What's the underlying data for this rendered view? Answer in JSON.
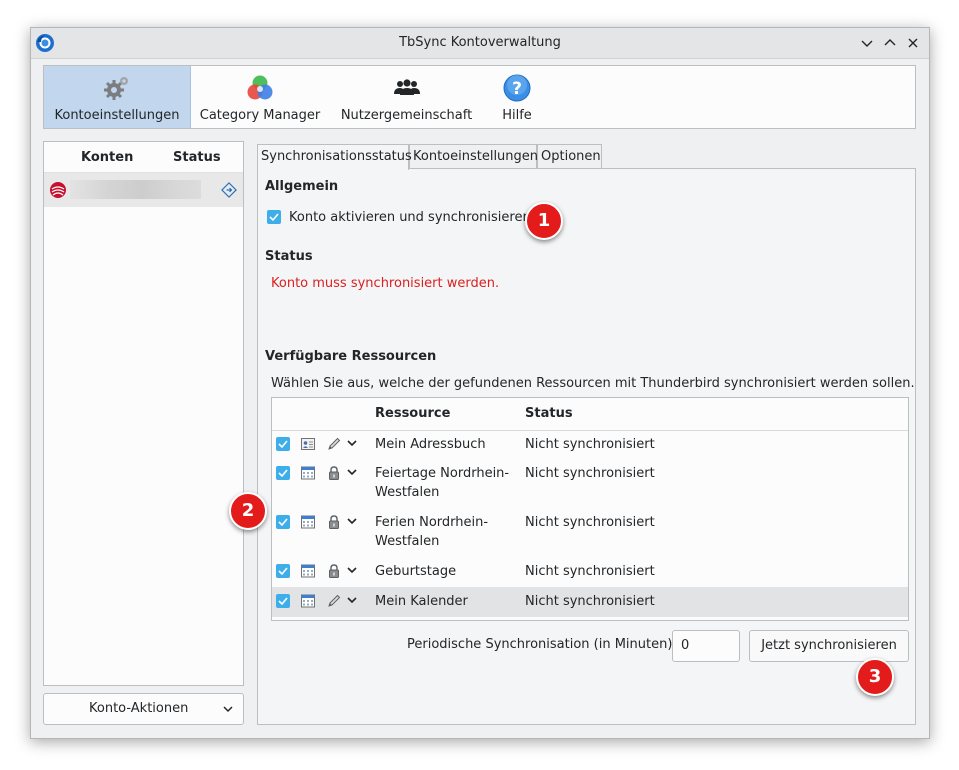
{
  "window": {
    "title": "TbSync Kontoverwaltung"
  },
  "toolbar": {
    "items": [
      {
        "label": "Kontoeinstellungen",
        "icon": "gears-icon"
      },
      {
        "label": "Category Manager",
        "icon": "category-manager-icon"
      },
      {
        "label": "Nutzergemeinschaft",
        "icon": "community-icon"
      },
      {
        "label": "Hilfe",
        "icon": "help-icon"
      }
    ]
  },
  "accounts": {
    "headers": {
      "name": "Konten",
      "status": "Status"
    },
    "actions_label": "Konto-Aktionen"
  },
  "tabs": [
    "Synchronisationsstatus",
    "Kontoeinstellungen",
    "Optionen"
  ],
  "general": {
    "heading": "Allgemein",
    "enable_label": "Konto aktivieren und synchronisieren"
  },
  "status": {
    "heading": "Status",
    "message": "Konto muss synchronisiert werden."
  },
  "resources": {
    "heading": "Verfügbare Ressourcen",
    "description": "Wählen Sie aus, welche der gefundenen Ressourcen mit Thunderbird synchronisiert werden sollen.",
    "headers": {
      "resource": "Ressource",
      "status": "Status"
    },
    "rows": [
      {
        "name_line1": "Mein Adressbuch",
        "name_line2": "",
        "status": "Nicht synchronisiert",
        "type_icon": "addressbook-icon",
        "access_icon": "pencil-icon"
      },
      {
        "name_line1": "Feiertage Nordrhein-",
        "name_line2": "Westfalen",
        "status": "Nicht synchronisiert",
        "type_icon": "calendar-icon",
        "access_icon": "lock-icon"
      },
      {
        "name_line1": "Ferien Nordrhein-",
        "name_line2": "Westfalen",
        "status": "Nicht synchronisiert",
        "type_icon": "calendar-icon",
        "access_icon": "lock-icon"
      },
      {
        "name_line1": "Geburtstage",
        "name_line2": "",
        "status": "Nicht synchronisiert",
        "type_icon": "calendar-icon",
        "access_icon": "lock-icon"
      },
      {
        "name_line1": "Mein Kalender",
        "name_line2": "",
        "status": "Nicht synchronisiert",
        "type_icon": "calendar-icon",
        "access_icon": "pencil-icon"
      }
    ]
  },
  "periodic": {
    "label": "Periodische Synchronisation (in Minuten)",
    "value": "0"
  },
  "sync_button": "Jetzt synchronisieren",
  "badges": [
    "1",
    "2",
    "3"
  ],
  "colors": {
    "accent": "#3daee9",
    "selection": "#c2d7ee",
    "error": "#da2021",
    "badge": "#e41b1b"
  }
}
